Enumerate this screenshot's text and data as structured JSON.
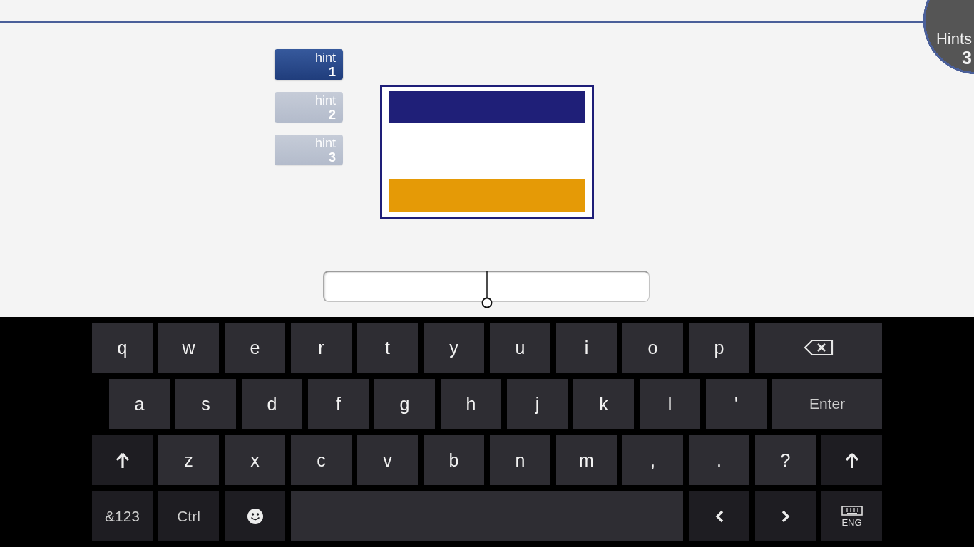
{
  "hints_badge": {
    "label": "Hints",
    "count": "3"
  },
  "hint_buttons": [
    {
      "label": "hint",
      "number": "1",
      "selected": true
    },
    {
      "label": "hint",
      "number": "2",
      "selected": false
    },
    {
      "label": "hint",
      "number": "3",
      "selected": false
    }
  ],
  "answer_field": {
    "focused": true
  },
  "keyboard": {
    "rows": [
      {
        "keys": [
          {
            "kind": "char",
            "label": "q"
          },
          {
            "kind": "char",
            "label": "w"
          },
          {
            "kind": "char",
            "label": "e"
          },
          {
            "kind": "char",
            "label": "r"
          },
          {
            "kind": "char",
            "label": "t"
          },
          {
            "kind": "char",
            "label": "y"
          },
          {
            "kind": "char",
            "label": "u"
          },
          {
            "kind": "char",
            "label": "i"
          },
          {
            "kind": "char",
            "label": "o"
          },
          {
            "kind": "char",
            "label": "p"
          },
          {
            "kind": "backspace"
          }
        ]
      },
      {
        "keys": [
          {
            "kind": "char",
            "label": "a"
          },
          {
            "kind": "char",
            "label": "s"
          },
          {
            "kind": "char",
            "label": "d"
          },
          {
            "kind": "char",
            "label": "f"
          },
          {
            "kind": "char",
            "label": "g"
          },
          {
            "kind": "char",
            "label": "h"
          },
          {
            "kind": "char",
            "label": "j"
          },
          {
            "kind": "char",
            "label": "k"
          },
          {
            "kind": "char",
            "label": "l"
          },
          {
            "kind": "char",
            "label": "'"
          },
          {
            "kind": "enter",
            "label": "Enter"
          }
        ]
      },
      {
        "keys": [
          {
            "kind": "shift"
          },
          {
            "kind": "char",
            "label": "z"
          },
          {
            "kind": "char",
            "label": "x"
          },
          {
            "kind": "char",
            "label": "c"
          },
          {
            "kind": "char",
            "label": "v"
          },
          {
            "kind": "char",
            "label": "b"
          },
          {
            "kind": "char",
            "label": "n"
          },
          {
            "kind": "char",
            "label": "m"
          },
          {
            "kind": "char",
            "label": ","
          },
          {
            "kind": "char",
            "label": "."
          },
          {
            "kind": "char",
            "label": "?"
          },
          {
            "kind": "shift"
          }
        ]
      },
      {
        "keys": [
          {
            "kind": "symbols",
            "label": "&123"
          },
          {
            "kind": "ctrl",
            "label": "Ctrl"
          },
          {
            "kind": "emoji"
          },
          {
            "kind": "space"
          },
          {
            "kind": "left"
          },
          {
            "kind": "right"
          },
          {
            "kind": "layout",
            "label": "ENG"
          }
        ]
      }
    ]
  }
}
